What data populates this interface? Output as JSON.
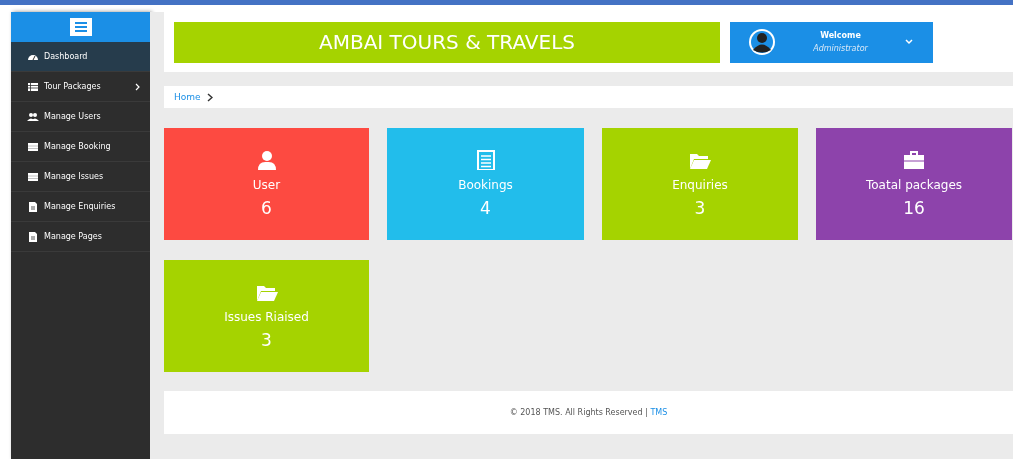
{
  "sidebar": {
    "items": [
      {
        "label": "Dashboard",
        "kind": "gauge",
        "selected": true,
        "submenu": false
      },
      {
        "label": "Tour Packages",
        "kind": "list",
        "selected": false,
        "submenu": true
      },
      {
        "label": "Manage Users",
        "kind": "users",
        "selected": false,
        "submenu": false
      },
      {
        "label": "Manage Booking",
        "kind": "table",
        "selected": false,
        "submenu": false
      },
      {
        "label": "Manage Issues",
        "kind": "table",
        "selected": false,
        "submenu": false
      },
      {
        "label": "Manage Enquiries",
        "kind": "file",
        "selected": false,
        "submenu": false
      },
      {
        "label": "Manage Pages",
        "kind": "file",
        "selected": false,
        "submenu": false
      }
    ]
  },
  "header": {
    "title": "AMBAI TOURS & TRAVELS",
    "user": {
      "greeting": "Welcome",
      "role": "Administrator"
    }
  },
  "breadcrumb": {
    "items": [
      "Home"
    ]
  },
  "cards": [
    {
      "label": "User",
      "value": "6",
      "kind": "user",
      "color": "#fd4a41"
    },
    {
      "label": "Bookings",
      "value": "4",
      "kind": "list",
      "color": "#22bdeb"
    },
    {
      "label": "Enquiries",
      "value": "3",
      "kind": "folder",
      "color": "#a5d300"
    },
    {
      "label": "Toatal packages",
      "value": "16",
      "kind": "briefcase",
      "color": "#8d43ab"
    },
    {
      "label": "Issues Riaised",
      "value": "3",
      "kind": "folder",
      "color": "#a5d300"
    }
  ],
  "footer": {
    "text": "© 2018 TMS. All Rights Reserved | ",
    "link": "TMS"
  }
}
